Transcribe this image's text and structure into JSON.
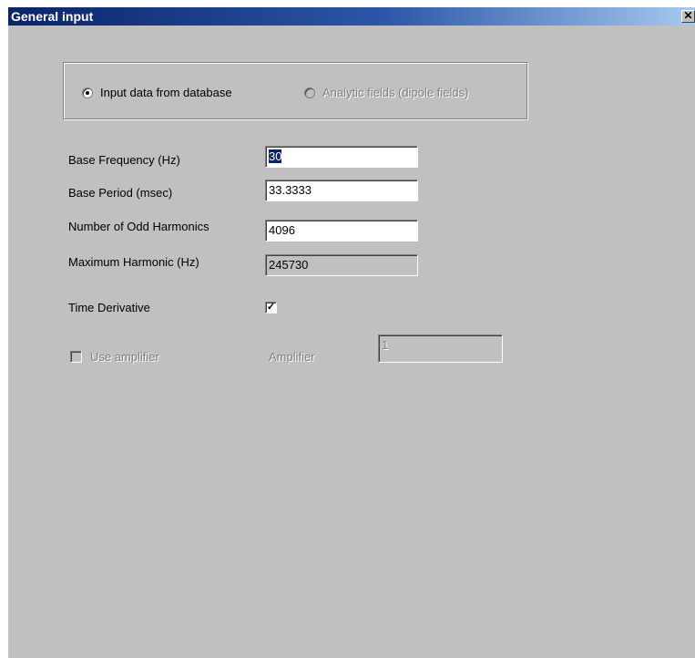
{
  "window": {
    "title": "General input",
    "close_glyph": "✕"
  },
  "source_group": {
    "options": [
      {
        "label": "Input data from database",
        "checked": true,
        "enabled": true
      },
      {
        "label": "Analytic fields (dipole fields)",
        "checked": false,
        "enabled": false
      }
    ]
  },
  "fields": {
    "base_frequency": {
      "label": "Base Frequency (Hz)",
      "value": "30"
    },
    "base_period": {
      "label": "Base Period (msec)",
      "value": "33.3333"
    },
    "odd_harmonics": {
      "label": "Number of Odd Harmonics",
      "value": "4096"
    },
    "max_harmonic": {
      "label": "Maximum Harmonic (Hz)",
      "value": "245730"
    }
  },
  "time_derivative": {
    "label": "Time Derivative",
    "checked": true,
    "check_glyph": "✓"
  },
  "amplifier": {
    "use_label": "Use amplifier",
    "use_checked": false,
    "label": "Amplifier",
    "value": "1"
  },
  "colors": {
    "titlebar_start": "#0a246a",
    "titlebar_end": "#a6caf0",
    "face": "#c0c0c0",
    "disabled_text": "#808080"
  }
}
